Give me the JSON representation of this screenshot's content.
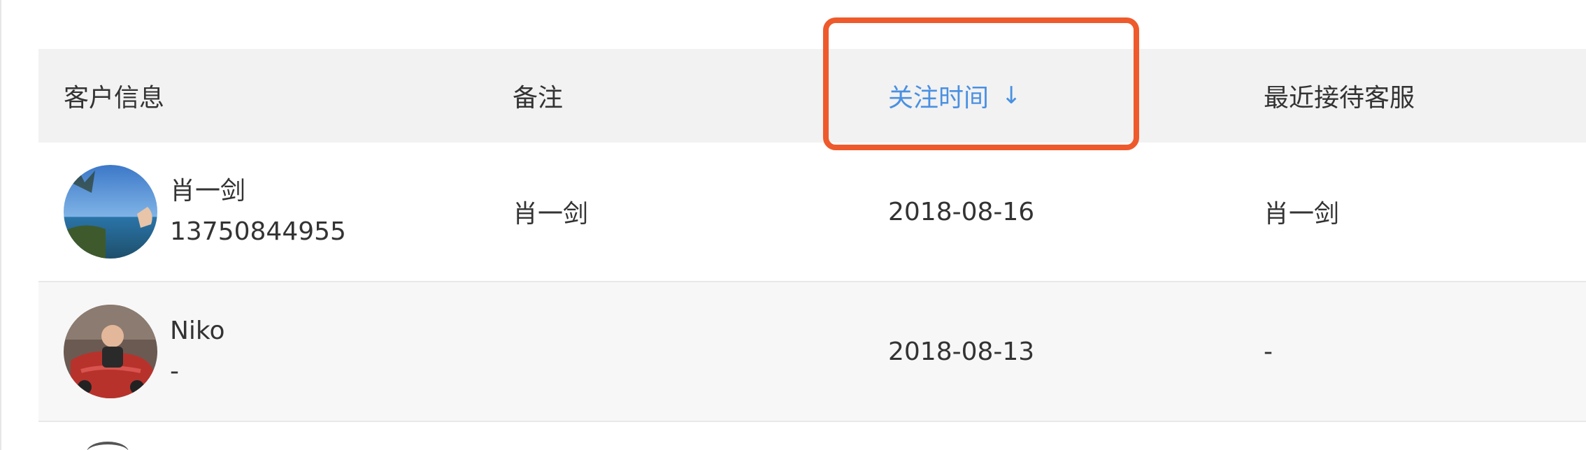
{
  "table": {
    "headers": {
      "customer_info": "客户信息",
      "note": "备注",
      "follow_time": "关注时间",
      "follow_time_sort_arrow": "↓",
      "last_agent": "最近接待客服"
    },
    "rows": [
      {
        "name": "肖一剑",
        "phone": "13750844955",
        "note": "肖一剑",
        "follow_time": "2018-08-16",
        "last_agent": "肖一剑"
      },
      {
        "name": "Niko",
        "phone": "-",
        "note": "",
        "follow_time": "2018-08-13",
        "last_agent": "-"
      }
    ]
  },
  "colors": {
    "header_bg": "#f2f2f2",
    "sort_active": "#4a90e2",
    "highlight_border": "#ee5a2c",
    "row_alt_bg": "#f7f7f7"
  },
  "icons": {
    "sort": "arrow-down-icon",
    "avatar_1": "avatar-photo",
    "avatar_2": "avatar-photo"
  }
}
